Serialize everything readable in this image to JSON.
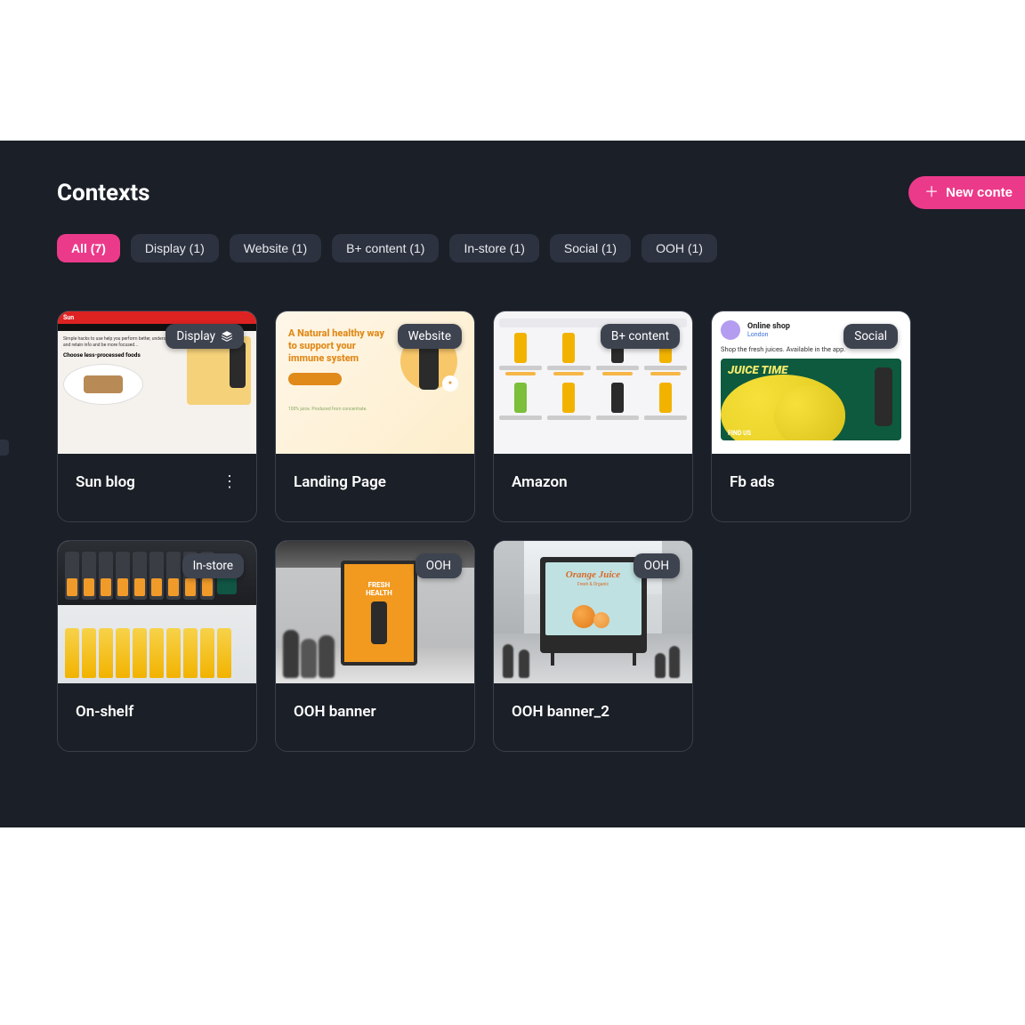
{
  "header": {
    "title": "Contexts",
    "new_button": "New conte"
  },
  "filters": [
    {
      "label": "All (7)",
      "active": true
    },
    {
      "label": "Display (1)",
      "active": false
    },
    {
      "label": "Website (1)",
      "active": false
    },
    {
      "label": "B+ content (1)",
      "active": false
    },
    {
      "label": "In-store (1)",
      "active": false
    },
    {
      "label": "Social (1)",
      "active": false
    },
    {
      "label": "OOH (1)",
      "active": false
    }
  ],
  "cards": [
    {
      "title": "Sun blog",
      "tag": "Display",
      "has_menu": true
    },
    {
      "title": "Landing Page",
      "tag": "Website",
      "has_menu": false
    },
    {
      "title": "Amazon",
      "tag": "B+ content",
      "has_menu": false
    },
    {
      "title": "Fb ads",
      "tag": "Social",
      "has_menu": false
    },
    {
      "title": "On-shelf",
      "tag": "In-store",
      "has_menu": false
    },
    {
      "title": "OOH banner",
      "tag": "OOH",
      "has_menu": false
    },
    {
      "title": "OOH banner_2",
      "tag": "OOH",
      "has_menu": false
    }
  ],
  "thumb_text": {
    "landing_headline": "A Natural healthy way to support your immune system",
    "social_name": "Online shop",
    "social_location": "London",
    "social_caption": "Shop the fresh juices. Available in the app.",
    "social_ad_title": "JUICE TIME",
    "social_ad_footer": "FIND US",
    "ooh1_line1": "FRESH",
    "ooh1_line2": "HEALTH",
    "ooh2_title": "Orange Juice",
    "ooh2_sub": "Fresh & Organic"
  }
}
